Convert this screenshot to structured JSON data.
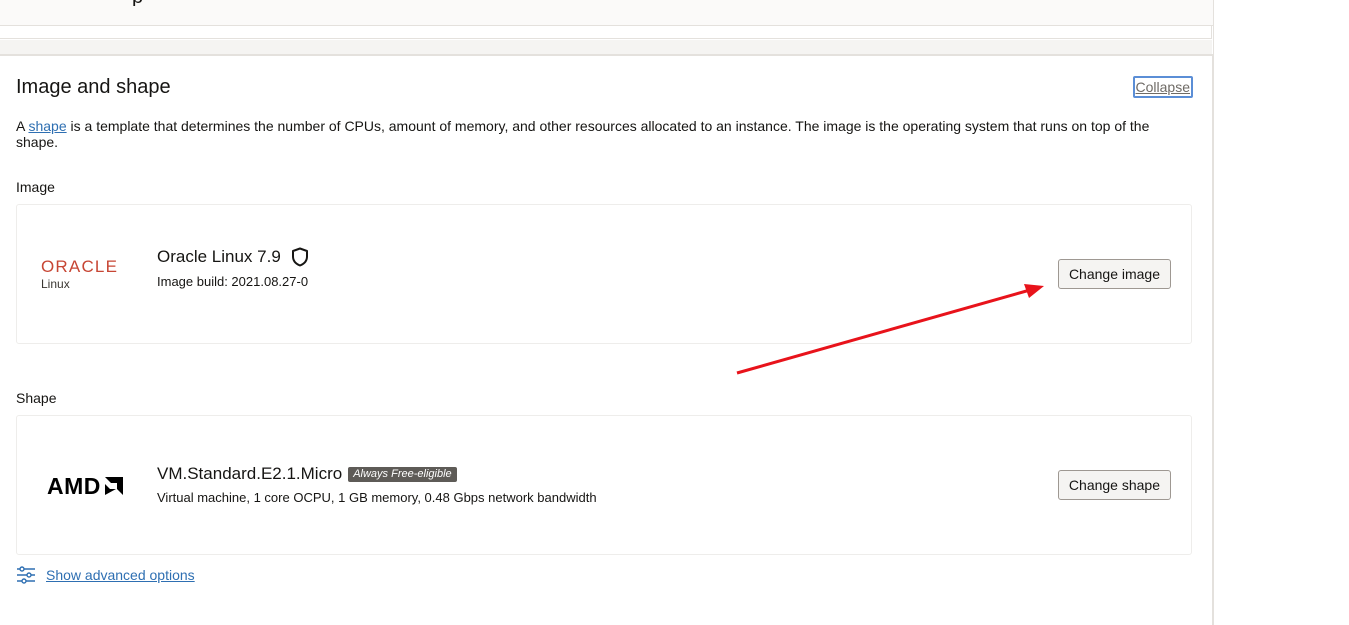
{
  "previous_section": {
    "title_fragment": "p"
  },
  "card": {
    "title": "Image and shape",
    "collapse_label": "Collapse",
    "description_prefix": "A ",
    "description_link": "shape",
    "description_suffix": " is a template that determines the number of CPUs, amount of memory, and other resources allocated to an instance. The image is the operating system that runs on top of the shape."
  },
  "image": {
    "section_label": "Image",
    "logo_word": "ORACLE",
    "logo_sub": "Linux",
    "name": "Oracle Linux 7.9",
    "icon": "shield-icon",
    "build": "Image build: 2021.08.27-0",
    "button_label": "Change image"
  },
  "shape": {
    "section_label": "Shape",
    "logo_word": "AMD",
    "name": "VM.Standard.E2.1.Micro",
    "badge": "Always Free-eligible",
    "details": "Virtual machine, 1 core OCPU, 1 GB memory, 0.48 Gbps network bandwidth",
    "button_label": "Change shape"
  },
  "advanced": {
    "icon": "sliders-icon",
    "label": "Show advanced options"
  },
  "colors": {
    "oracle_red": "#c74634",
    "link_blue": "#2e6fb2",
    "annotation_arrow": "#e8131b",
    "badge_bg": "#5e5b57"
  }
}
